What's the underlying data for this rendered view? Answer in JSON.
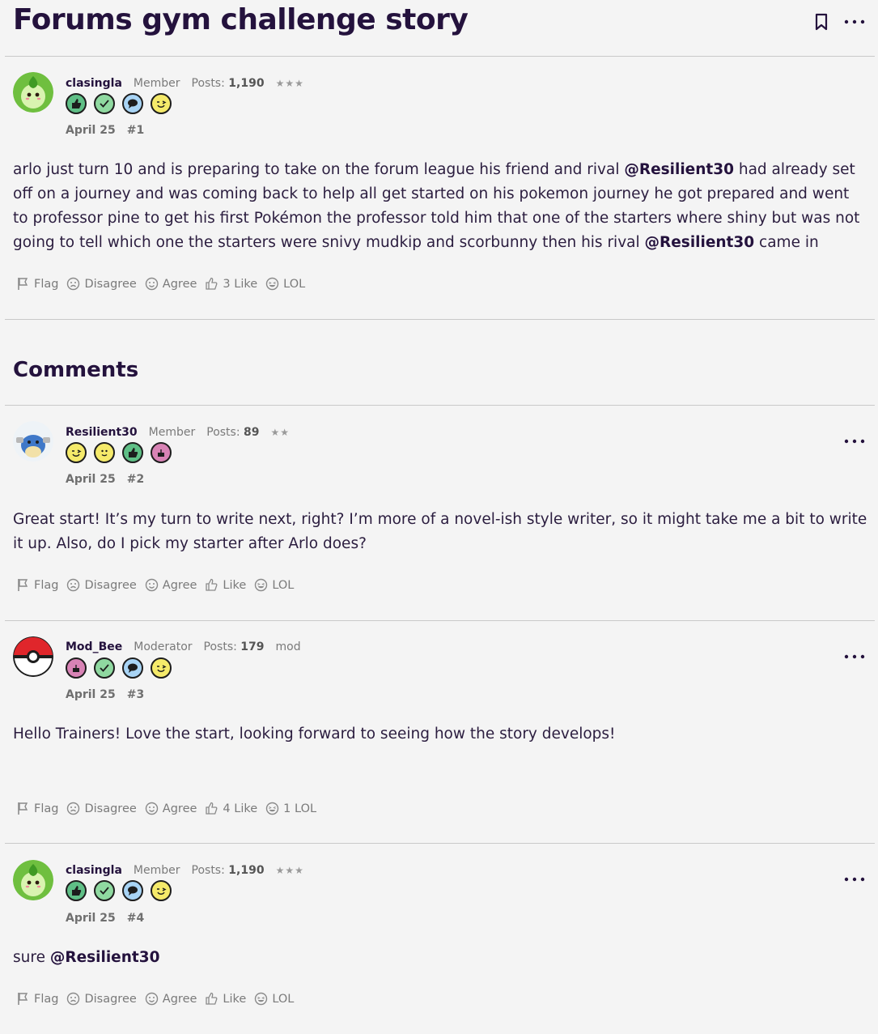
{
  "page": {
    "title": "Forums gym challenge story"
  },
  "comments_heading": "Comments",
  "reaction_labels": {
    "flag": "Flag",
    "disagree": "Disagree",
    "agree": "Agree",
    "like": "Like",
    "lol": "LOL"
  },
  "posts": [
    {
      "username": "clasingla",
      "role": "Member",
      "posts_label": "Posts:",
      "posts_count": "1,190",
      "rank": "★★★",
      "date": "April 25",
      "number": "#1",
      "body": [
        "arlo just turn 10 and is preparing to take on the forum league his friend and rival ",
        "@Resilient30",
        " had already set off on a journey and was coming back to help all get started on his pokemon journey he got prepared and went to professor pine to get his first Pokémon the professor told him that one of the starters where shiny but was not going to tell which one the starters were snivy mudkip and scorbunny then his rival ",
        "@Resilient30",
        " came in"
      ],
      "like_count": "3 ",
      "lol_count": ""
    },
    {
      "username": "Resilient30",
      "role": "Member",
      "posts_label": "Posts:",
      "posts_count": "89",
      "rank": "★★",
      "date": "April 25",
      "number": "#2",
      "body": "Great start! It’s my turn to write next, right? I’m more of a novel-ish style writer, so it might take me a bit to write it up. Also, do I pick my starter after Arlo does?",
      "like_count": "",
      "lol_count": ""
    },
    {
      "username": "Mod_Bee",
      "role": "Moderator",
      "posts_label": "Posts:",
      "posts_count": "179",
      "rank": "mod",
      "date": "April 25",
      "number": "#3",
      "body": "Hello Trainers! Love the start, looking forward to seeing how the story develops!",
      "like_count": "4 ",
      "lol_count": "1 "
    },
    {
      "username": "clasingla",
      "role": "Member",
      "posts_label": "Posts:",
      "posts_count": "1,190",
      "rank": "★★★",
      "date": "April 25",
      "number": "#4",
      "body": [
        "sure ",
        "@Resilient30"
      ],
      "like_count": "",
      "lol_count": ""
    }
  ],
  "colors": {
    "accent": "#24123d",
    "background": "#f4f4f4",
    "muted": "#7a7a7a"
  },
  "icons": [
    "bookmark-icon",
    "more-icon",
    "flag-icon",
    "disagree-icon",
    "agree-icon",
    "like-icon",
    "lol-icon"
  ]
}
